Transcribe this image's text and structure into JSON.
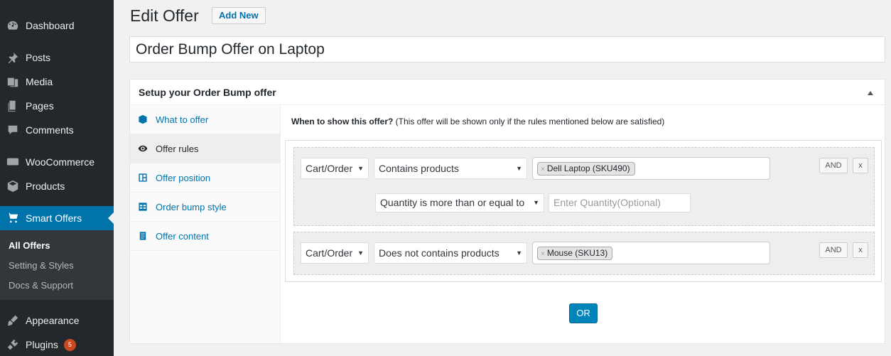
{
  "sidebar": {
    "dashboard": "Dashboard",
    "posts": "Posts",
    "media": "Media",
    "pages": "Pages",
    "comments": "Comments",
    "woocommerce": "WooCommerce",
    "products": "Products",
    "smart_offers": "Smart Offers",
    "appearance": "Appearance",
    "plugins": "Plugins",
    "plugins_badge": "5",
    "submenu": {
      "all_offers": "All Offers",
      "settings": "Setting & Styles",
      "docs": "Docs & Support"
    }
  },
  "header": {
    "title": "Edit Offer",
    "add_new": "Add New"
  },
  "offer_title": "Order Bump Offer on Laptop",
  "postbox": {
    "title": "Setup your Order Bump offer",
    "tabs": [
      {
        "label": "What to offer",
        "icon": "cube-icon"
      },
      {
        "label": "Offer rules",
        "icon": "eye-icon"
      },
      {
        "label": "Offer position",
        "icon": "layout-icon"
      },
      {
        "label": "Order bump style",
        "icon": "table-icon"
      },
      {
        "label": "Offer content",
        "icon": "document-icon"
      }
    ],
    "intro_bold": "When to show this offer?",
    "intro_rest": " (This offer will be shown only if the rules mentioned below are satisfied)"
  },
  "rules": [
    {
      "scope": "Cart/Order",
      "condition": "Contains products",
      "products": [
        "Dell Laptop (SKU490)"
      ],
      "quantity_condition": "Quantity is more than or equal to",
      "quantity_placeholder": "Enter Quantity(Optional)",
      "and_label": "AND",
      "remove_label": "x"
    },
    {
      "scope": "Cart/Order",
      "condition": "Does not contains products",
      "products": [
        "Mouse (SKU13)"
      ],
      "and_label": "AND",
      "remove_label": "x"
    }
  ],
  "or_label": "OR",
  "chip_remove": "×",
  "caret": "▼",
  "colors": {
    "sidebar_bg": "#23282d",
    "active_menu": "#0073aa",
    "link": "#0073aa",
    "button_primary": "#0085ba",
    "badge": "#ca4a1f"
  }
}
